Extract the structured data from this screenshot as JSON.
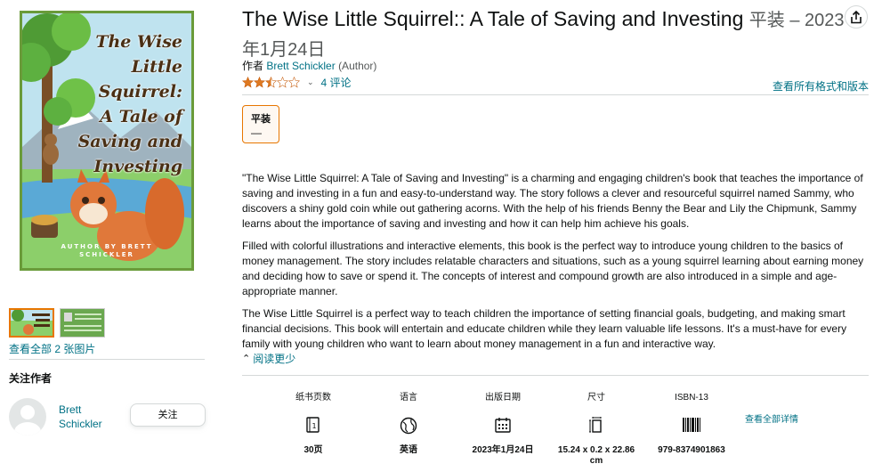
{
  "product": {
    "title": "The Wise Little Squirrel:: A Tale of Saving and Investing",
    "format_date": "平装 – 2023年1月24日",
    "byline_prefix": "作者",
    "author": "Brett Schickler",
    "author_role": "(Author)",
    "rating": 2.5,
    "reviews_label": "4 评论",
    "all_formats_link": "查看所有格式和版本"
  },
  "cover": {
    "title_lines": [
      "The Wise",
      "Little",
      "Squirrel:",
      "A Tale of",
      "Saving and",
      "Investing"
    ],
    "author_line1": "AUTHOR BY BRETT",
    "author_line2": "SCHICKLER"
  },
  "formats": [
    {
      "name": "平装",
      "price": "—"
    }
  ],
  "description": [
    "\"The Wise Little Squirrel: A Tale of Saving and Investing\" is a charming and engaging children's book that teaches the importance of saving and investing in a fun and easy-to-understand way. The story follows a clever and resourceful squirrel named Sammy, who discovers a shiny gold coin while out gathering acorns. With the help of his friends Benny the Bear and Lily the Chipmunk, Sammy learns about the importance of saving and investing and how it can help him achieve his goals.",
    "Filled with colorful illustrations and interactive elements, this book is the perfect way to introduce young children to the basics of money management. The story includes relatable characters and situations, such as a young squirrel learning about earning money and deciding how to save or spend it. The concepts of interest and compound growth are also introduced in a simple and age-appropriate manner.",
    "The Wise Little Squirrel is a perfect way to teach children the importance of setting financial goals, budgeting, and making smart financial decisions. This book will entertain and educate children while they learn valuable life lessons. It's a must-have for every family with young children who want to learn about money management in a fun and interactive way."
  ],
  "read_less": "阅读更少",
  "left": {
    "see_all_images": "查看全部 2 张图片",
    "follow_title": "关注作者",
    "author_first": "Brett",
    "author_last": "Schickler",
    "follow_button": "关注"
  },
  "details": [
    {
      "label": "纸书页数",
      "value": "30页",
      "icon": "book-pages-icon"
    },
    {
      "label": "语言",
      "value": "英语",
      "icon": "globe-icon"
    },
    {
      "label": "出版日期",
      "value": "2023年1月24日",
      "icon": "calendar-icon"
    },
    {
      "label": "尺寸",
      "value": "15.24 x 0.2 x 22.86 cm",
      "icon": "dimensions-icon"
    },
    {
      "label": "ISBN-13",
      "value": "979-8374901863",
      "icon": "barcode-icon"
    }
  ],
  "see_all_details": "查看全部详情",
  "colors": {
    "link": "#007185",
    "star": "#de7921",
    "selected_border": "#e77600",
    "cover_border": "#6a9b3a"
  }
}
